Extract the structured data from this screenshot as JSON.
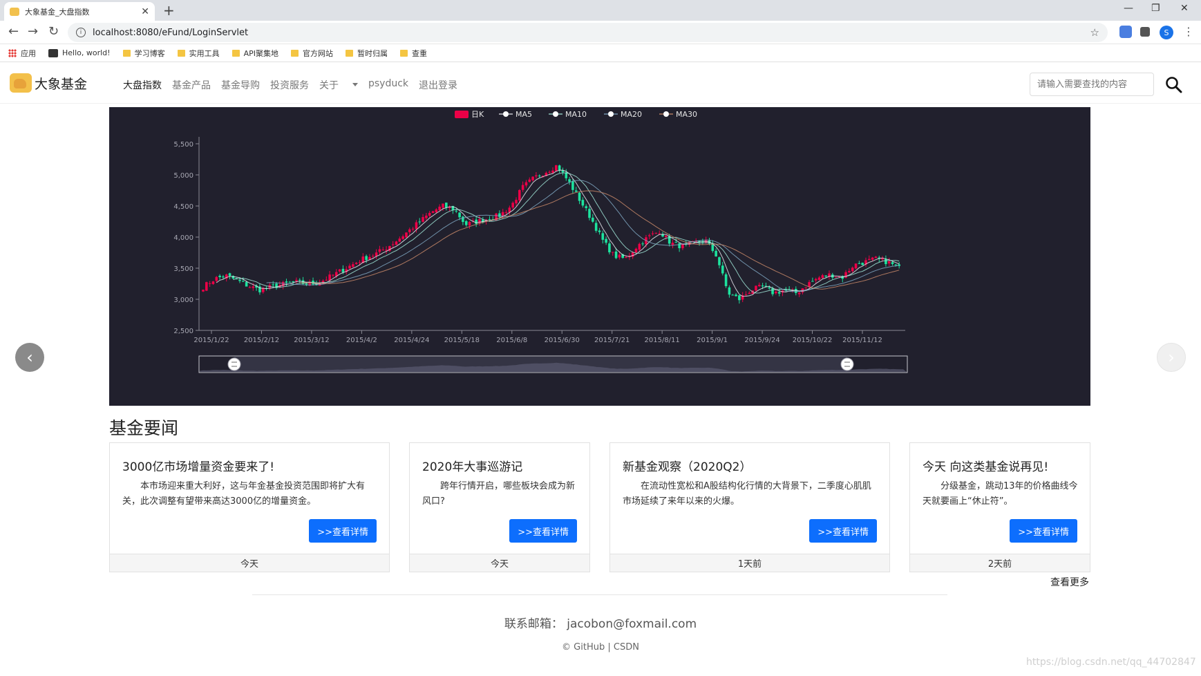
{
  "browser": {
    "tab_title": "大象基金_大盘指数",
    "new_tab": "+",
    "url": "localhost:8080/eFund/LoginServlet",
    "profile_initial": "S",
    "bookmarks": [
      "应用",
      "Hello, world!",
      "学习博客",
      "实用工具",
      "API聚集地",
      "官方网站",
      "暂时归属",
      "查重"
    ]
  },
  "site": {
    "brand": "大象基金",
    "menu": [
      "大盘指数",
      "基金产品",
      "基金导购",
      "投资服务",
      "关于",
      "psyduck",
      "退出登录"
    ],
    "search_placeholder": "请输入需要查找的内容"
  },
  "chart_data": {
    "type": "candlestick",
    "legend": [
      "日K",
      "MA5",
      "MA10",
      "MA20",
      "MA30"
    ],
    "ylim": [
      2500,
      5500
    ],
    "yticks": [
      "2,500",
      "3,000",
      "3,500",
      "4,000",
      "4,500",
      "5,000",
      "5,500"
    ],
    "xticks": [
      "2015/1/22",
      "2015/2/12",
      "2015/3/12",
      "2015/4/2",
      "2015/4/24",
      "2015/5/18",
      "2015/6/8",
      "2015/6/30",
      "2015/7/21",
      "2015/8/11",
      "2015/9/1",
      "2015/9/24",
      "2015/10/22",
      "2015/11/12"
    ],
    "close_path": [
      3200,
      3330,
      3380,
      3300,
      3210,
      3150,
      3200,
      3240,
      3280,
      3250,
      3260,
      3350,
      3450,
      3550,
      3650,
      3720,
      3820,
      3950,
      4100,
      4250,
      4400,
      4500,
      4450,
      4200,
      4250,
      4300,
      4350,
      4500,
      4800,
      4950,
      5050,
      5150,
      4900,
      4600,
      4300,
      3950,
      3700,
      3650,
      3850,
      4000,
      4100,
      3900,
      3850,
      3900,
      3950,
      3700,
      3100,
      3000,
      3150,
      3200,
      3100,
      3150,
      3100,
      3250,
      3350,
      3400,
      3350,
      3550,
      3600,
      3650,
      3600,
      3500
    ],
    "colors": {
      "up": "#ec0047",
      "down": "#1de29e",
      "ma5": "#e8e8f0",
      "ma10": "#9fe4d6",
      "ma20": "#7fa7c2",
      "ma30": "#c9896a",
      "background": "#21202d"
    }
  },
  "news": {
    "title": "基金要闻",
    "items": [
      {
        "title": "3000亿市场增量资金要来了!",
        "body": "本市场迎来重大利好，这与年金基金投资范围即将扩大有关，此次调整有望带来高达3000亿的增量资金。",
        "button": ">>查看详情",
        "time": "今天"
      },
      {
        "title": "2020年大事巡游记",
        "body": "跨年行情开启，哪些板块会成为新风口?",
        "button": ">>查看详情",
        "time": "今天"
      },
      {
        "title": "新基金观察（2020Q2）",
        "body": "在流动性宽松和A股结构化行情的大背景下，二季度心肌肌市场延续了来年以来的火爆。",
        "button": ">>查看详情",
        "time": "1天前"
      },
      {
        "title": "今天 向这类基金说再见!",
        "body": "分级基金，跳动13年的价格曲线今天就要画上“休止符”。",
        "button": ">>查看详情",
        "time": "2天前"
      }
    ],
    "more": "查看更多"
  },
  "footer": {
    "contact_label": "联系邮箱：",
    "contact_email": "jacobon@foxmail.com",
    "copyright": "© GitHub | CSDN",
    "watermark": "https://blog.csdn.net/qq_44702847"
  }
}
